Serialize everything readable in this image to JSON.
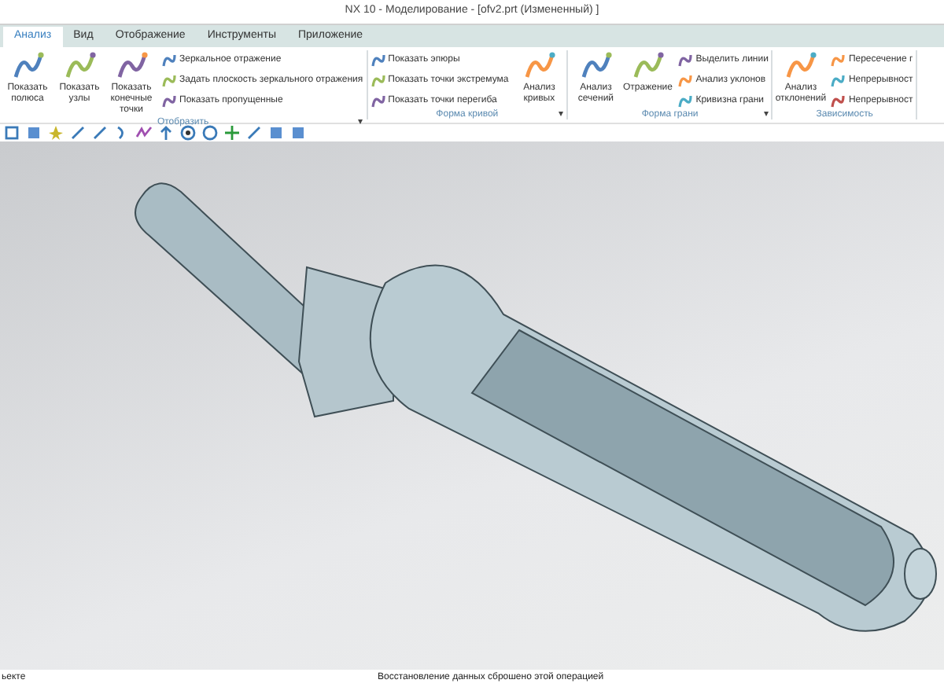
{
  "window": {
    "title": "NX 10 - Моделирование - [ofv2.prt (Измененный) ]"
  },
  "tabs": [
    {
      "label": "Анализ",
      "selected": true
    },
    {
      "label": "Вид",
      "selected": false
    },
    {
      "label": "Отображение",
      "selected": false
    },
    {
      "label": "Инструменты",
      "selected": false
    },
    {
      "label": "Приложение",
      "selected": false
    }
  ],
  "ribbon_groups": [
    {
      "title": "Отобразить",
      "menu_icon": "▾",
      "columns": [
        {
          "kind": "large",
          "items": [
            "Показать полюса",
            "Показать узлы",
            "Показать конечные точки"
          ]
        },
        {
          "kind": "small",
          "items": [
            "Зеркальное отражение",
            "Задать плоскость зеркального отражения",
            "Показать пропущенные"
          ]
        }
      ]
    },
    {
      "title": "Форма кривой",
      "menu_icon": "▾",
      "columns": [
        {
          "kind": "small",
          "items": [
            "Показать эпюры",
            "Показать точки экстремума",
            "Показать точки перегиба"
          ]
        },
        {
          "kind": "large",
          "items": [
            "Анализ кривых"
          ]
        }
      ]
    },
    {
      "title": "Форма грани",
      "menu_icon": "▾",
      "columns": [
        {
          "kind": "large",
          "items": [
            "Анализ сечений",
            "Отражение"
          ]
        },
        {
          "kind": "small",
          "items": [
            "Выделить линии",
            "Анализ уклонов",
            "Кривизна грани"
          ]
        }
      ]
    },
    {
      "title": "Зависимость",
      "columns": [
        {
          "kind": "large",
          "items": [
            "Анализ отклонений"
          ]
        },
        {
          "kind": "small",
          "items": [
            "Пересечение г",
            "Непрерывност",
            "Непрерывност"
          ]
        }
      ]
    }
  ],
  "status_bar": {
    "left": "ьекте",
    "message": "Восстановление данных сброшено этой операцией"
  }
}
